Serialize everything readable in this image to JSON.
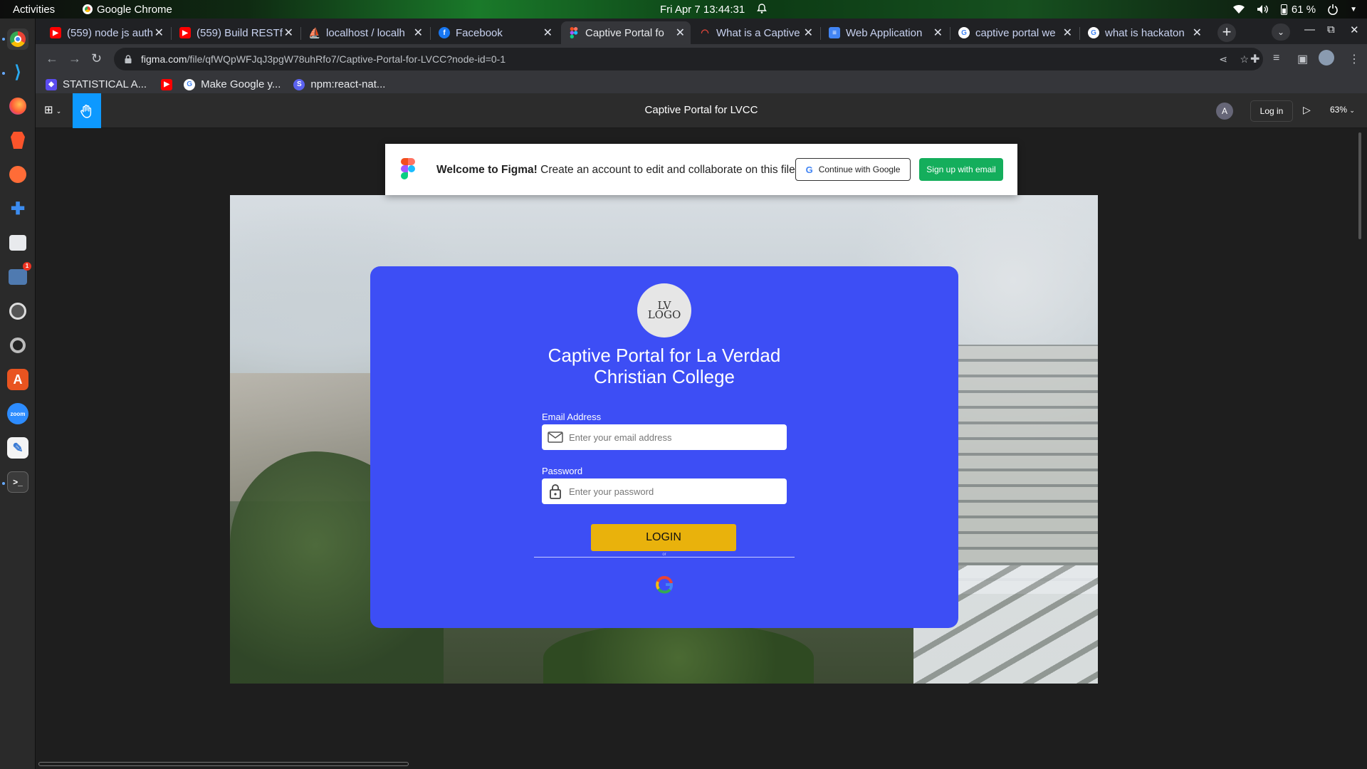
{
  "system": {
    "activities": "Activities",
    "app_name": "Google Chrome",
    "clock": "Fri Apr 7  13:44:31",
    "battery": "61 %"
  },
  "browser": {
    "tabs": [
      {
        "title": "(559) node js auth",
        "favicon": "youtube-icon",
        "color": "#ff0000"
      },
      {
        "title": "(559) Build RESTf",
        "favicon": "youtube-icon",
        "color": "#ff0000"
      },
      {
        "title": "localhost / localh",
        "favicon": "phpmyadmin-icon",
        "color": "#f0a030"
      },
      {
        "title": "Facebook",
        "favicon": "facebook-icon",
        "color": "#1877f2"
      },
      {
        "title": "Captive Portal fo",
        "favicon": "figma-icon",
        "color": "#f24e1e"
      },
      {
        "title": "What is a Captive",
        "favicon": "wifi-icon",
        "color": "#e0453a"
      },
      {
        "title": "Web Application",
        "favicon": "docs-icon",
        "color": "#4285f4"
      },
      {
        "title": "captive portal we",
        "favicon": "google-icon",
        "color": "#ffffff"
      },
      {
        "title": "what is hackaton",
        "favicon": "google-icon",
        "color": "#ffffff"
      }
    ],
    "active_tab_index": 4,
    "url_host": "figma.com",
    "url_path": "/file/qfWQpWFJqJ3pgW78uhRfo7/Captive-Portal-for-LVCC?node-id=0-1",
    "bookmarks": [
      {
        "label": "STATISTICAL A...",
        "icon": "bookmark-shield-icon"
      },
      {
        "label": "",
        "icon": "youtube-icon"
      },
      {
        "label": "Make Google y...",
        "icon": "google-icon"
      },
      {
        "label": "npm:react-nat...",
        "icon": "npm-icon"
      }
    ]
  },
  "figma": {
    "file_title": "Captive Portal for LVCC",
    "avatar_letter": "A",
    "login_label": "Log in",
    "zoom": "63%",
    "banner": {
      "welcome": "Welcome to Figma!",
      "message": " Create an account to edit and collaborate on this file.",
      "google_button": "Continue with Google",
      "email_button": "Sign up with email"
    }
  },
  "portal": {
    "logo_line1": "LV",
    "logo_line2": "LOGO",
    "title": "Captive Portal for La Verdad Christian College",
    "email_label": "Email Address",
    "email_placeholder": "Enter your email address",
    "password_label": "Password",
    "password_placeholder": "Enter your password",
    "login_button": "LOGIN",
    "divider_text": "or"
  },
  "colors": {
    "card": "#3d4ef5",
    "login_button": "#e9b20c",
    "figma_accent": "#0d99ff",
    "signup_green": "#14ae5c"
  }
}
